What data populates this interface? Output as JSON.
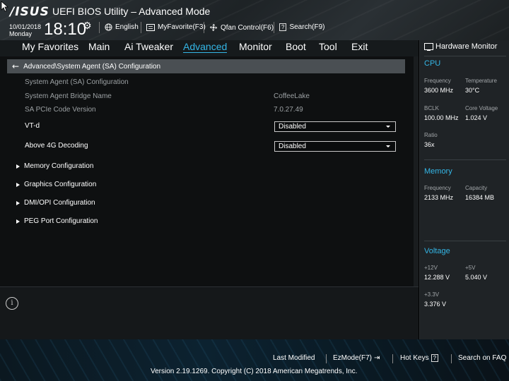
{
  "header": {
    "logo": "/ISUS",
    "title": "UEFI BIOS Utility – Advanced Mode",
    "date": "10/01/2018",
    "day": "Monday",
    "time": "18:10",
    "language": "English",
    "favorite": "MyFavorite(F3)",
    "qfan": "Qfan Control(F6)",
    "search": "Search(F9)",
    "icons": [
      "cursor-icon",
      "gear-icon",
      "globe-icon",
      "favorite-icon",
      "fan-icon",
      "search-help-icon"
    ]
  },
  "nav": {
    "tabs": [
      "My Favorites",
      "Main",
      "Ai Tweaker",
      "Advanced",
      "Monitor",
      "Boot",
      "Tool",
      "Exit"
    ],
    "active": "Advanced"
  },
  "main": {
    "breadcrumb": "Advanced\\System Agent (SA) Configuration",
    "section_title": "System Agent (SA) Configuration",
    "info": [
      {
        "label": "System Agent Bridge Name",
        "value": "CoffeeLake"
      },
      {
        "label": "SA PCIe Code Version",
        "value": "7.0.27.49"
      }
    ],
    "settings": [
      {
        "label": "VT-d",
        "value": "Disabled"
      },
      {
        "label": "Above 4G Decoding",
        "value": "Disabled"
      }
    ],
    "submenus": [
      "Memory Configuration",
      "Graphics Configuration",
      "DMI/OPI Configuration",
      "PEG Port Configuration"
    ]
  },
  "hw": {
    "title": "Hardware Monitor",
    "cpu": {
      "heading": "CPU",
      "frequency_label": "Frequency",
      "frequency": "3600 MHz",
      "temperature_label": "Temperature",
      "temperature": "30°C",
      "bclk_label": "BCLK",
      "bclk": "100.00 MHz",
      "core_voltage_label": "Core Voltage",
      "core_voltage": "1.024 V",
      "ratio_label": "Ratio",
      "ratio": "36x"
    },
    "memory": {
      "heading": "Memory",
      "frequency_label": "Frequency",
      "frequency": "2133 MHz",
      "capacity_label": "Capacity",
      "capacity": "16384 MB"
    },
    "voltage": {
      "heading": "Voltage",
      "v12_label": "+12V",
      "v12": "12.288 V",
      "v5_label": "+5V",
      "v5": "5.040 V",
      "v33_label": "+3.3V",
      "v33": "3.376 V"
    }
  },
  "footer": {
    "last_modified": "Last Modified",
    "ezmode": "EzMode(F7)",
    "hotkeys": "Hot Keys",
    "hotkeys_key": "?",
    "faq": "Search on FAQ",
    "copyright": "Version 2.19.1269. Copyright (C) 2018 American Megatrends, Inc."
  },
  "colors": {
    "accent": "#34b6e6",
    "background": "#0e1011",
    "panel": "#1f2326"
  }
}
